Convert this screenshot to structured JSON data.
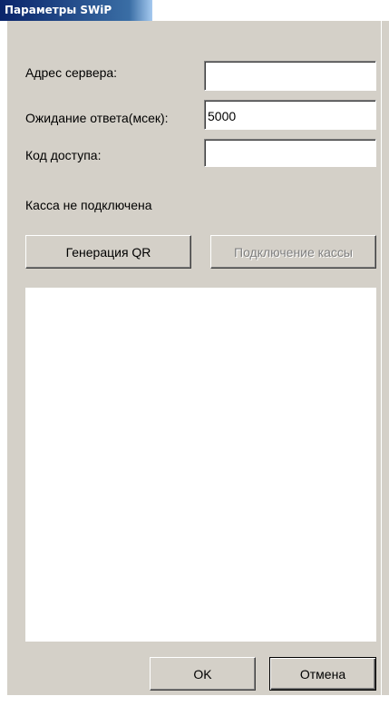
{
  "window": {
    "title": "Параметры SWiP"
  },
  "form": {
    "server_address": {
      "label": "Адрес сервера:",
      "value": ""
    },
    "timeout": {
      "label": "Ожидание ответа(мсек):",
      "value": "5000"
    },
    "access_code": {
      "label": "Код доступа:",
      "value": ""
    }
  },
  "status": {
    "text": "Касса не подключена"
  },
  "actions": {
    "generate_qr_label": "Генерация QR",
    "connect_register_label": "Подключение кассы"
  },
  "dialog_buttons": {
    "ok_label": "OK",
    "cancel_label": "Отмена"
  }
}
